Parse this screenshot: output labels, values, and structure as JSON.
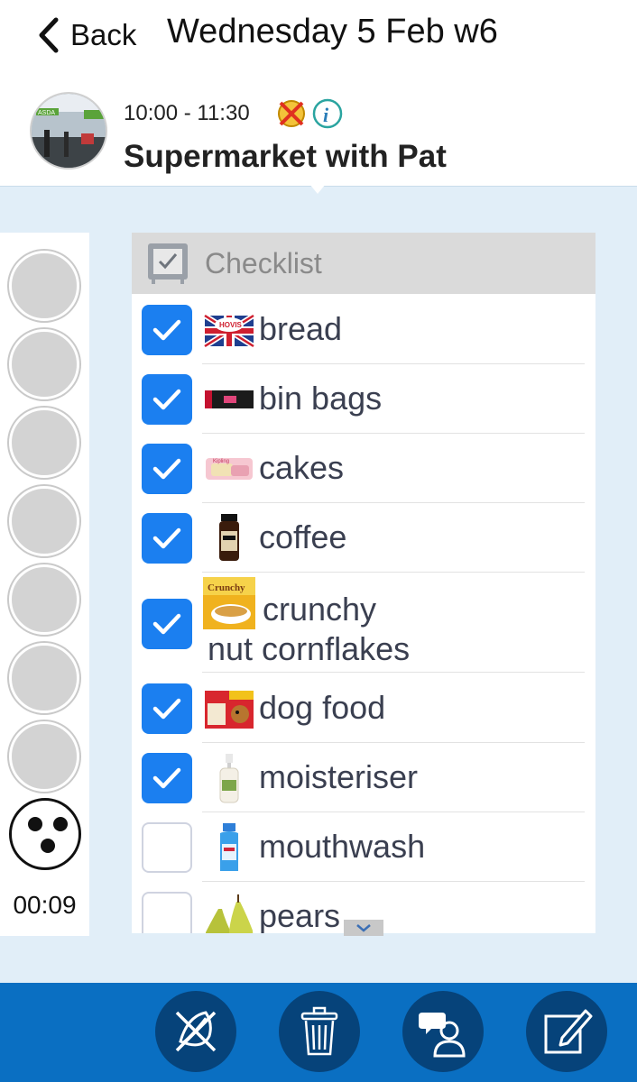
{
  "header": {
    "back_label": "Back",
    "title": "Wednesday 5 Feb w6"
  },
  "activity": {
    "time": "10:00 - 11:30",
    "title": "Supermarket with Pat",
    "photo_icon": "supermarket-photo",
    "time_icons": [
      "no-reminder-icon",
      "info-icon"
    ]
  },
  "progress": {
    "steps_total": 8,
    "steps_pending": 7,
    "timer": "00:09"
  },
  "checklist": {
    "title": "Checklist",
    "items": [
      {
        "label": "bread",
        "checked": true,
        "icon": "bread-icon"
      },
      {
        "label": "bin bags",
        "checked": true,
        "icon": "bin-bags-icon"
      },
      {
        "label": "cakes",
        "checked": true,
        "icon": "cakes-icon"
      },
      {
        "label": "coffee",
        "checked": true,
        "icon": "coffee-jar-icon"
      },
      {
        "label_line1": "crunchy",
        "label_line2": "nut cornflakes",
        "checked": true,
        "icon": "cereal-box-icon"
      },
      {
        "label": "dog food",
        "checked": true,
        "icon": "dog-food-icon"
      },
      {
        "label": "moisteriser",
        "checked": true,
        "icon": "lotion-bottle-icon"
      },
      {
        "label": "mouthwash",
        "checked": false,
        "icon": "mouthwash-bottle-icon"
      },
      {
        "label": "pears",
        "checked": false,
        "icon": "pears-icon"
      }
    ]
  },
  "toolbar": {
    "buttons": [
      "cancel-activity-icon",
      "trash-icon",
      "participants-icon",
      "edit-icon"
    ]
  },
  "colors": {
    "accent": "#1b7ff0",
    "toolbar": "#0a6fc2",
    "toolbar_button": "#06437a",
    "panel": "#e1eef8"
  }
}
